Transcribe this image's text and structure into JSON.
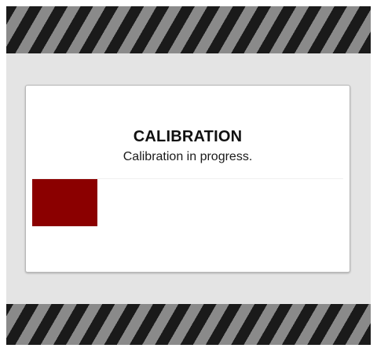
{
  "dialog": {
    "title": "CALIBRATION",
    "status_text": "Calibration in progress."
  },
  "progress": {
    "fraction": 0.21
  },
  "colors": {
    "hazard_dark": "#1a1a1a",
    "hazard_light": "#8a8a8a",
    "panel_background": "#e4e4e4",
    "progress_fill": "#8b0000"
  }
}
